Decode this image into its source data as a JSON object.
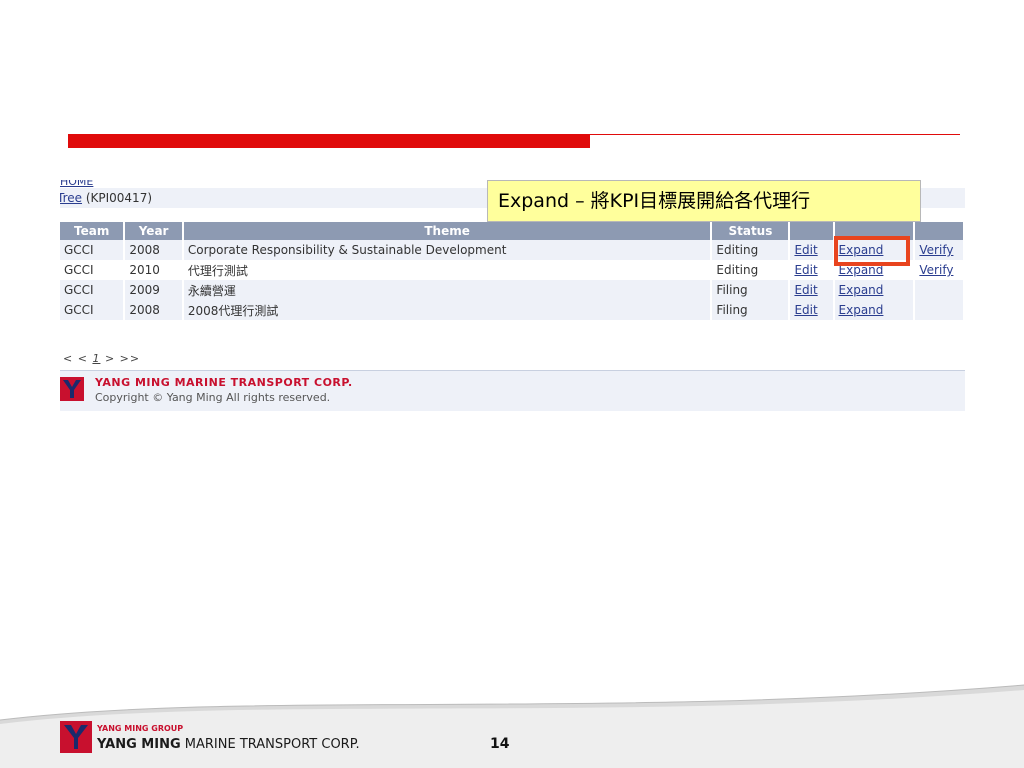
{
  "callout": {
    "text": "Expand – 將KPI目標展開給各代理行"
  },
  "app": {
    "breadcrumb": "HOME",
    "tree": {
      "link": "Tree",
      "suffix": " (KPI00417)"
    },
    "table": {
      "headers": [
        "Team",
        "Year",
        "Theme",
        "Status",
        "",
        "",
        ""
      ],
      "rows": [
        {
          "team": "GCCI",
          "year": "2008",
          "theme": "Corporate Responsibility & Sustainable Development",
          "status": "Editing",
          "edit": "Edit",
          "expand": "Expand",
          "verify": "Verify"
        },
        {
          "team": "GCCI",
          "year": "2010",
          "theme": "代理行測試",
          "status": "Editing",
          "edit": "Edit",
          "expand": "Expand",
          "verify": "Verify"
        },
        {
          "team": "GCCI",
          "year": "2009",
          "theme": "永續營運",
          "status": "Filing",
          "edit": "Edit",
          "expand": "Expand",
          "verify": ""
        },
        {
          "team": "GCCI",
          "year": "2008",
          "theme": "2008代理行測試",
          "status": "Filing",
          "edit": "Edit",
          "expand": "Expand",
          "verify": ""
        }
      ]
    },
    "pager": {
      "prev": "< <",
      "current": "1",
      "next": "> >>"
    },
    "footer": {
      "corp": "YANG MING MARINE TRANSPORT CORP.",
      "copyright": "Copyright © Yang Ming All rights reserved."
    }
  },
  "slide_footer": {
    "group": "YANG MING GROUP",
    "corp_bold": "YANG MING",
    "corp_rest": " MARINE TRANSPORT CORP.",
    "page_number": "14"
  },
  "colors": {
    "accent_red": "#e00b0b",
    "highlight": "#e8441e",
    "callout_bg": "#ffff9c",
    "header_bg": "#8d9ab2"
  }
}
